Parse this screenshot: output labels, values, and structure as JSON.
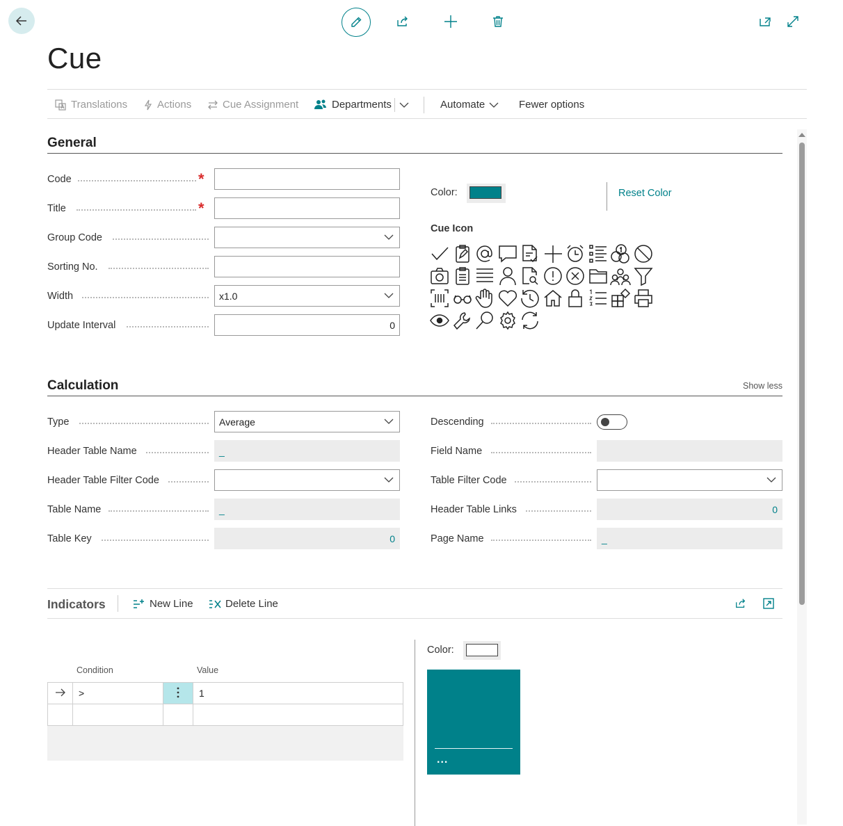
{
  "page": {
    "title": "Cue"
  },
  "actions": {
    "translations": "Translations",
    "actions": "Actions",
    "cue_assignment": "Cue Assignment",
    "departments": "Departments",
    "automate": "Automate",
    "fewer_options": "Fewer options"
  },
  "general": {
    "heading": "General",
    "code_label": "Code",
    "title_label": "Title",
    "group_code_label": "Group Code",
    "sorting_no_label": "Sorting No.",
    "width_label": "Width",
    "width_value": "x1.0",
    "update_interval_label": "Update Interval",
    "update_interval_value": "0",
    "color_label": "Color:",
    "color_value": "#00818a",
    "reset_color": "Reset Color",
    "cue_icon_label": "Cue Icon"
  },
  "calculation": {
    "heading": "Calculation",
    "show_less": "Show less",
    "type_label": "Type",
    "type_value": "Average",
    "header_table_name_label": "Header Table Name",
    "header_table_name_value": "_",
    "header_table_filter_code_label": "Header Table Filter Code",
    "table_name_label": "Table Name",
    "table_name_value": "_",
    "table_key_label": "Table Key",
    "table_key_value": "0",
    "descending_label": "Descending",
    "field_name_label": "Field Name",
    "table_filter_code_label": "Table Filter Code",
    "header_table_links_label": "Header Table Links",
    "header_table_links_value": "0",
    "page_name_label": "Page Name",
    "page_name_value": "_"
  },
  "indicators": {
    "heading": "Indicators",
    "new_line": "New Line",
    "delete_line": "Delete Line",
    "col_condition": "Condition",
    "col_value": "Value",
    "row1_condition": ">",
    "row1_value": "1",
    "color_label": "Color:",
    "tile_color": "#00818a",
    "tile_more": "..."
  },
  "icons": [
    "checkmark-icon",
    "clipboard-edit-icon",
    "at-sign-icon",
    "comment-icon",
    "document-check-icon",
    "plus-icon",
    "alarm-clock-icon",
    "bullet-list-icon",
    "coins-icon",
    "prohibited-icon",
    "camera-icon",
    "clipboard-list-icon",
    "lines-icon",
    "person-icon",
    "document-search-icon",
    "warning-circle-icon",
    "dismiss-circle-icon",
    "folder-icon",
    "people-group-icon",
    "filter-icon",
    "barcode-scan-icon",
    "glasses-icon",
    "hand-icon",
    "heart-icon",
    "history-icon",
    "home-icon",
    "lock-icon",
    "numbered-list-icon",
    "apps-add-icon",
    "printer-icon",
    "eye-icon",
    "wrench-icon",
    "search-icon",
    "settings-icon",
    "refresh-icon"
  ]
}
